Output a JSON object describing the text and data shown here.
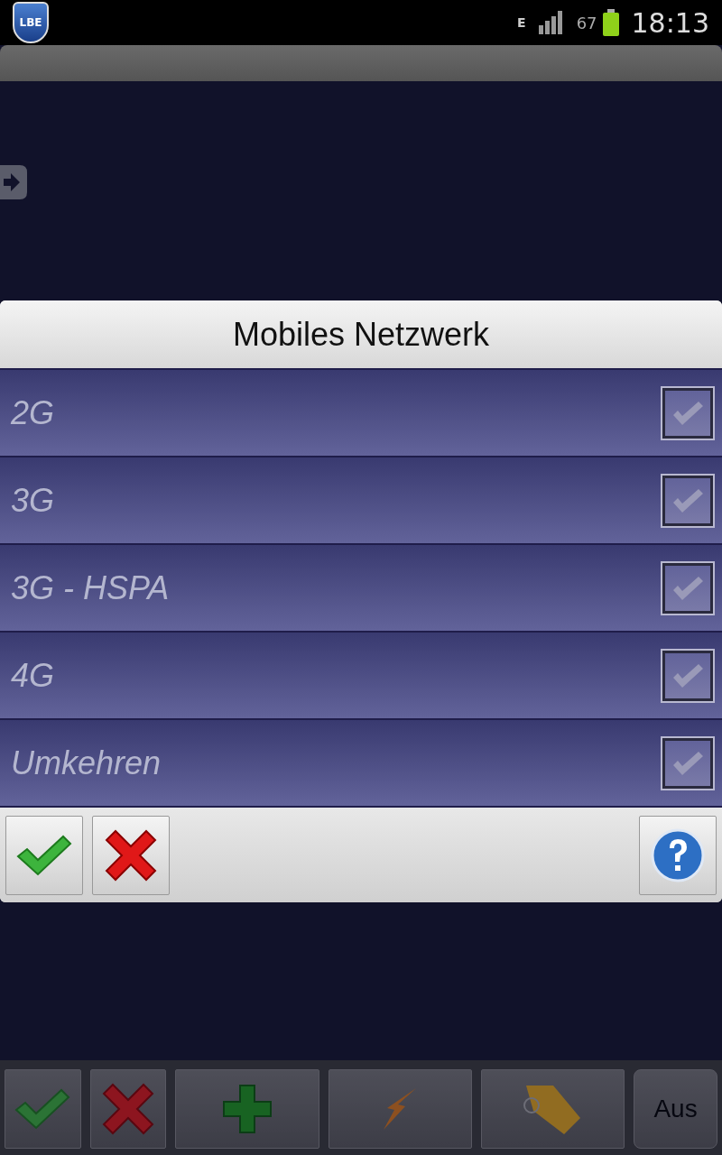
{
  "status_bar": {
    "app_badge": "LBE",
    "network": "E",
    "battery": "67",
    "time": "18:13"
  },
  "dialog": {
    "title": "Mobiles Netzwerk",
    "options": [
      {
        "label": "2G",
        "checked": true,
        "disabled": true
      },
      {
        "label": "3G",
        "checked": true,
        "disabled": true
      },
      {
        "label": "3G - HSPA",
        "checked": true,
        "disabled": true
      },
      {
        "label": "4G",
        "checked": true,
        "disabled": true
      },
      {
        "label": "Umkehren",
        "checked": true,
        "disabled": true
      }
    ],
    "buttons": [
      {
        "kind": "ok"
      },
      {
        "kind": "cancel"
      },
      {
        "kind": "help"
      }
    ]
  },
  "toolbar": [
    {
      "kind": "ok"
    },
    {
      "kind": "cancel"
    },
    {
      "kind": "add"
    },
    {
      "kind": "bolt"
    },
    {
      "kind": "tag"
    },
    {
      "kind": "text",
      "label": "Aus"
    }
  ]
}
